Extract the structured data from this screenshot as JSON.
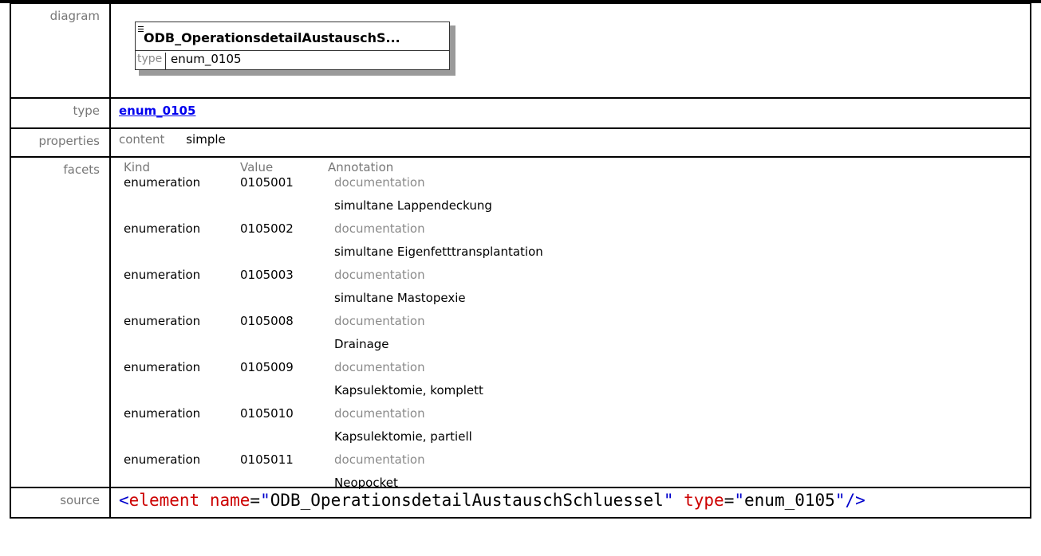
{
  "labels": {
    "diagram": "diagram",
    "type": "type",
    "properties": "properties",
    "facets": "facets",
    "source": "source"
  },
  "diagram": {
    "element_name": "ODB_OperationsdetailAustauschS...",
    "type_label": "type",
    "type_value": "enum_0105"
  },
  "type": {
    "link": "enum_0105"
  },
  "properties": {
    "key": "content",
    "value": "simple"
  },
  "facets": {
    "headers": {
      "kind": "Kind",
      "value": "Value",
      "annotation": "Annotation"
    },
    "rows": [
      {
        "kind": "enumeration",
        "value": "0105001",
        "doc_label": "documentation",
        "doc": "simultane Lappendeckung"
      },
      {
        "kind": "enumeration",
        "value": "0105002",
        "doc_label": "documentation",
        "doc": "simultane Eigenfetttransplantation"
      },
      {
        "kind": "enumeration",
        "value": "0105003",
        "doc_label": "documentation",
        "doc": "simultane Mastopexie"
      },
      {
        "kind": "enumeration",
        "value": "0105008",
        "doc_label": "documentation",
        "doc": "Drainage"
      },
      {
        "kind": "enumeration",
        "value": "0105009",
        "doc_label": "documentation",
        "doc": "Kapsulektomie, komplett"
      },
      {
        "kind": "enumeration",
        "value": "0105010",
        "doc_label": "documentation",
        "doc": "Kapsulektomie, partiell"
      },
      {
        "kind": "enumeration",
        "value": "0105011",
        "doc_label": "documentation",
        "doc": "Neopocket"
      }
    ]
  },
  "source": {
    "open": "<",
    "element": "element",
    "attr1_name": "name",
    "attr1_value": "ODB_OperationsdetailAustauschSchluessel",
    "attr2_name": "type",
    "attr2_value": "enum_0105",
    "close": "/>"
  }
}
